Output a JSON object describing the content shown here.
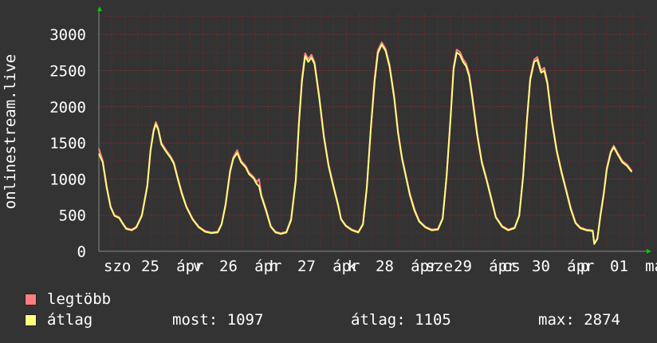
{
  "chart_data": {
    "type": "line",
    "ylabel": "onlinestream.live",
    "ylim": [
      0,
      3300
    ],
    "yticks": [
      0,
      500,
      1000,
      1500,
      2000,
      2500,
      3000
    ],
    "grid": true,
    "xlim": [
      0,
      7.0
    ],
    "xticks": [
      {
        "x": 0.0,
        "label": "szo"
      },
      {
        "x": 0.48,
        "label": "25"
      },
      {
        "x": 0.93,
        "label": "ápr"
      },
      {
        "x": 1.14,
        "label": "v"
      },
      {
        "x": 1.48,
        "label": "26"
      },
      {
        "x": 1.93,
        "label": "ápr"
      },
      {
        "x": 2.12,
        "label": "h"
      },
      {
        "x": 2.48,
        "label": "27"
      },
      {
        "x": 2.93,
        "label": "ápr"
      },
      {
        "x": 3.12,
        "label": "k"
      },
      {
        "x": 3.48,
        "label": "28"
      },
      {
        "x": 3.93,
        "label": "ápr"
      },
      {
        "x": 4.12,
        "label": "sze"
      },
      {
        "x": 4.48,
        "label": "29"
      },
      {
        "x": 4.93,
        "label": "ápr"
      },
      {
        "x": 5.1,
        "label": "cs"
      },
      {
        "x": 5.48,
        "label": "30"
      },
      {
        "x": 5.93,
        "label": "ápr"
      },
      {
        "x": 6.1,
        "label": "p"
      },
      {
        "x": 6.48,
        "label": "01"
      },
      {
        "x": 6.93,
        "label": "má"
      }
    ],
    "series": [
      {
        "name": "legtöbb",
        "color": "#ff7f7f",
        "points": [
          [
            0.0,
            1420
          ],
          [
            0.05,
            1250
          ],
          [
            0.1,
            900
          ],
          [
            0.15,
            620
          ],
          [
            0.2,
            500
          ],
          [
            0.26,
            470
          ],
          [
            0.3,
            400
          ],
          [
            0.35,
            320
          ],
          [
            0.42,
            300
          ],
          [
            0.48,
            340
          ],
          [
            0.55,
            500
          ],
          [
            0.62,
            920
          ],
          [
            0.66,
            1400
          ],
          [
            0.7,
            1680
          ],
          [
            0.73,
            1790
          ],
          [
            0.76,
            1700
          ],
          [
            0.8,
            1500
          ],
          [
            0.86,
            1400
          ],
          [
            0.92,
            1310
          ],
          [
            0.96,
            1230
          ],
          [
            1.0,
            1060
          ],
          [
            1.06,
            820
          ],
          [
            1.12,
            620
          ],
          [
            1.2,
            450
          ],
          [
            1.28,
            340
          ],
          [
            1.36,
            280
          ],
          [
            1.44,
            260
          ],
          [
            1.52,
            270
          ],
          [
            1.57,
            380
          ],
          [
            1.62,
            650
          ],
          [
            1.68,
            1120
          ],
          [
            1.72,
            1300
          ],
          [
            1.77,
            1400
          ],
          [
            1.82,
            1250
          ],
          [
            1.88,
            1180
          ],
          [
            1.92,
            1090
          ],
          [
            1.98,
            1030
          ],
          [
            2.02,
            960
          ],
          [
            2.05,
            1000
          ],
          [
            2.08,
            780
          ],
          [
            2.14,
            580
          ],
          [
            2.2,
            350
          ],
          [
            2.26,
            270
          ],
          [
            2.33,
            250
          ],
          [
            2.4,
            270
          ],
          [
            2.46,
            450
          ],
          [
            2.52,
            1000
          ],
          [
            2.56,
            1800
          ],
          [
            2.6,
            2400
          ],
          [
            2.64,
            2740
          ],
          [
            2.68,
            2660
          ],
          [
            2.72,
            2720
          ],
          [
            2.76,
            2620
          ],
          [
            2.82,
            2150
          ],
          [
            2.88,
            1600
          ],
          [
            2.94,
            1200
          ],
          [
            3.0,
            920
          ],
          [
            3.06,
            660
          ],
          [
            3.1,
            450
          ],
          [
            3.16,
            360
          ],
          [
            3.24,
            300
          ],
          [
            3.32,
            270
          ],
          [
            3.38,
            380
          ],
          [
            3.43,
            900
          ],
          [
            3.48,
            1700
          ],
          [
            3.53,
            2400
          ],
          [
            3.57,
            2780
          ],
          [
            3.62,
            2890
          ],
          [
            3.67,
            2800
          ],
          [
            3.72,
            2580
          ],
          [
            3.78,
            2150
          ],
          [
            3.83,
            1650
          ],
          [
            3.88,
            1300
          ],
          [
            3.93,
            1050
          ],
          [
            3.98,
            800
          ],
          [
            4.04,
            580
          ],
          [
            4.1,
            420
          ],
          [
            4.18,
            340
          ],
          [
            4.26,
            300
          ],
          [
            4.34,
            310
          ],
          [
            4.4,
            460
          ],
          [
            4.45,
            1050
          ],
          [
            4.5,
            1850
          ],
          [
            4.54,
            2550
          ],
          [
            4.58,
            2790
          ],
          [
            4.62,
            2760
          ],
          [
            4.66,
            2660
          ],
          [
            4.7,
            2600
          ],
          [
            4.74,
            2450
          ],
          [
            4.78,
            2150
          ],
          [
            4.84,
            1650
          ],
          [
            4.9,
            1250
          ],
          [
            4.96,
            1010
          ],
          [
            5.02,
            750
          ],
          [
            5.08,
            480
          ],
          [
            5.16,
            350
          ],
          [
            5.24,
            300
          ],
          [
            5.32,
            330
          ],
          [
            5.38,
            500
          ],
          [
            5.43,
            1050
          ],
          [
            5.48,
            1850
          ],
          [
            5.52,
            2400
          ],
          [
            5.57,
            2650
          ],
          [
            5.61,
            2690
          ],
          [
            5.66,
            2500
          ],
          [
            5.7,
            2540
          ],
          [
            5.74,
            2350
          ],
          [
            5.8,
            1800
          ],
          [
            5.86,
            1400
          ],
          [
            5.92,
            1110
          ],
          [
            5.98,
            860
          ],
          [
            6.04,
            600
          ],
          [
            6.1,
            400
          ],
          [
            6.16,
            330
          ],
          [
            6.24,
            300
          ],
          [
            6.32,
            290
          ],
          [
            6.34,
            110
          ],
          [
            6.38,
            180
          ],
          [
            6.42,
            520
          ],
          [
            6.46,
            800
          ],
          [
            6.5,
            1150
          ],
          [
            6.55,
            1380
          ],
          [
            6.59,
            1460
          ],
          [
            6.64,
            1360
          ],
          [
            6.7,
            1250
          ],
          [
            6.76,
            1200
          ],
          [
            6.82,
            1110
          ]
        ]
      },
      {
        "name": "átlag",
        "color": "#ffff80",
        "points": [
          [
            0.0,
            1350
          ],
          [
            0.05,
            1230
          ],
          [
            0.1,
            880
          ],
          [
            0.15,
            610
          ],
          [
            0.2,
            490
          ],
          [
            0.26,
            460
          ],
          [
            0.3,
            390
          ],
          [
            0.35,
            310
          ],
          [
            0.42,
            290
          ],
          [
            0.48,
            330
          ],
          [
            0.55,
            490
          ],
          [
            0.62,
            900
          ],
          [
            0.66,
            1380
          ],
          [
            0.7,
            1660
          ],
          [
            0.73,
            1760
          ],
          [
            0.76,
            1680
          ],
          [
            0.8,
            1480
          ],
          [
            0.86,
            1380
          ],
          [
            0.92,
            1290
          ],
          [
            0.96,
            1210
          ],
          [
            1.0,
            1040
          ],
          [
            1.06,
            800
          ],
          [
            1.12,
            610
          ],
          [
            1.2,
            440
          ],
          [
            1.28,
            330
          ],
          [
            1.36,
            270
          ],
          [
            1.44,
            250
          ],
          [
            1.52,
            260
          ],
          [
            1.57,
            370
          ],
          [
            1.62,
            630
          ],
          [
            1.68,
            1100
          ],
          [
            1.72,
            1280
          ],
          [
            1.77,
            1360
          ],
          [
            1.82,
            1230
          ],
          [
            1.88,
            1160
          ],
          [
            1.92,
            1070
          ],
          [
            1.98,
            1010
          ],
          [
            2.02,
            930
          ],
          [
            2.05,
            900
          ],
          [
            2.08,
            760
          ],
          [
            2.14,
            560
          ],
          [
            2.2,
            340
          ],
          [
            2.26,
            260
          ],
          [
            2.33,
            240
          ],
          [
            2.4,
            260
          ],
          [
            2.46,
            430
          ],
          [
            2.52,
            980
          ],
          [
            2.56,
            1760
          ],
          [
            2.6,
            2360
          ],
          [
            2.64,
            2700
          ],
          [
            2.68,
            2620
          ],
          [
            2.72,
            2680
          ],
          [
            2.76,
            2590
          ],
          [
            2.82,
            2120
          ],
          [
            2.88,
            1580
          ],
          [
            2.94,
            1180
          ],
          [
            3.0,
            900
          ],
          [
            3.06,
            640
          ],
          [
            3.1,
            440
          ],
          [
            3.16,
            350
          ],
          [
            3.24,
            290
          ],
          [
            3.32,
            260
          ],
          [
            3.38,
            370
          ],
          [
            3.43,
            880
          ],
          [
            3.48,
            1680
          ],
          [
            3.53,
            2360
          ],
          [
            3.57,
            2740
          ],
          [
            3.62,
            2860
          ],
          [
            3.67,
            2770
          ],
          [
            3.72,
            2550
          ],
          [
            3.78,
            2120
          ],
          [
            3.83,
            1630
          ],
          [
            3.88,
            1280
          ],
          [
            3.93,
            1030
          ],
          [
            3.98,
            780
          ],
          [
            4.04,
            560
          ],
          [
            4.1,
            410
          ],
          [
            4.18,
            330
          ],
          [
            4.26,
            290
          ],
          [
            4.34,
            300
          ],
          [
            4.4,
            450
          ],
          [
            4.45,
            1030
          ],
          [
            4.5,
            1820
          ],
          [
            4.54,
            2520
          ],
          [
            4.58,
            2750
          ],
          [
            4.62,
            2720
          ],
          [
            4.66,
            2620
          ],
          [
            4.7,
            2560
          ],
          [
            4.74,
            2420
          ],
          [
            4.78,
            2120
          ],
          [
            4.84,
            1620
          ],
          [
            4.9,
            1230
          ],
          [
            4.96,
            990
          ],
          [
            5.02,
            730
          ],
          [
            5.08,
            470
          ],
          [
            5.16,
            340
          ],
          [
            5.24,
            290
          ],
          [
            5.32,
            320
          ],
          [
            5.38,
            490
          ],
          [
            5.43,
            1030
          ],
          [
            5.48,
            1820
          ],
          [
            5.52,
            2370
          ],
          [
            5.57,
            2620
          ],
          [
            5.61,
            2650
          ],
          [
            5.66,
            2470
          ],
          [
            5.7,
            2500
          ],
          [
            5.74,
            2320
          ],
          [
            5.8,
            1780
          ],
          [
            5.86,
            1380
          ],
          [
            5.92,
            1090
          ],
          [
            5.98,
            840
          ],
          [
            6.04,
            580
          ],
          [
            6.1,
            390
          ],
          [
            6.16,
            320
          ],
          [
            6.24,
            290
          ],
          [
            6.32,
            280
          ],
          [
            6.34,
            100
          ],
          [
            6.38,
            170
          ],
          [
            6.42,
            500
          ],
          [
            6.46,
            780
          ],
          [
            6.5,
            1130
          ],
          [
            6.55,
            1360
          ],
          [
            6.59,
            1440
          ],
          [
            6.64,
            1340
          ],
          [
            6.7,
            1230
          ],
          [
            6.76,
            1180
          ],
          [
            6.82,
            1097
          ]
        ]
      }
    ]
  },
  "legend": {
    "items": [
      {
        "label": "legtöbb",
        "color": "#ff7f7f"
      },
      {
        "label": "átlag",
        "color": "#ffff80"
      }
    ],
    "stats": {
      "most": "most: 1097",
      "atlag": "átlag: 1105",
      "max": "max: 2874"
    }
  },
  "colors": {
    "background": "#333333",
    "grid": "#7a2a2a",
    "axis_arrow": "#00cc00"
  }
}
